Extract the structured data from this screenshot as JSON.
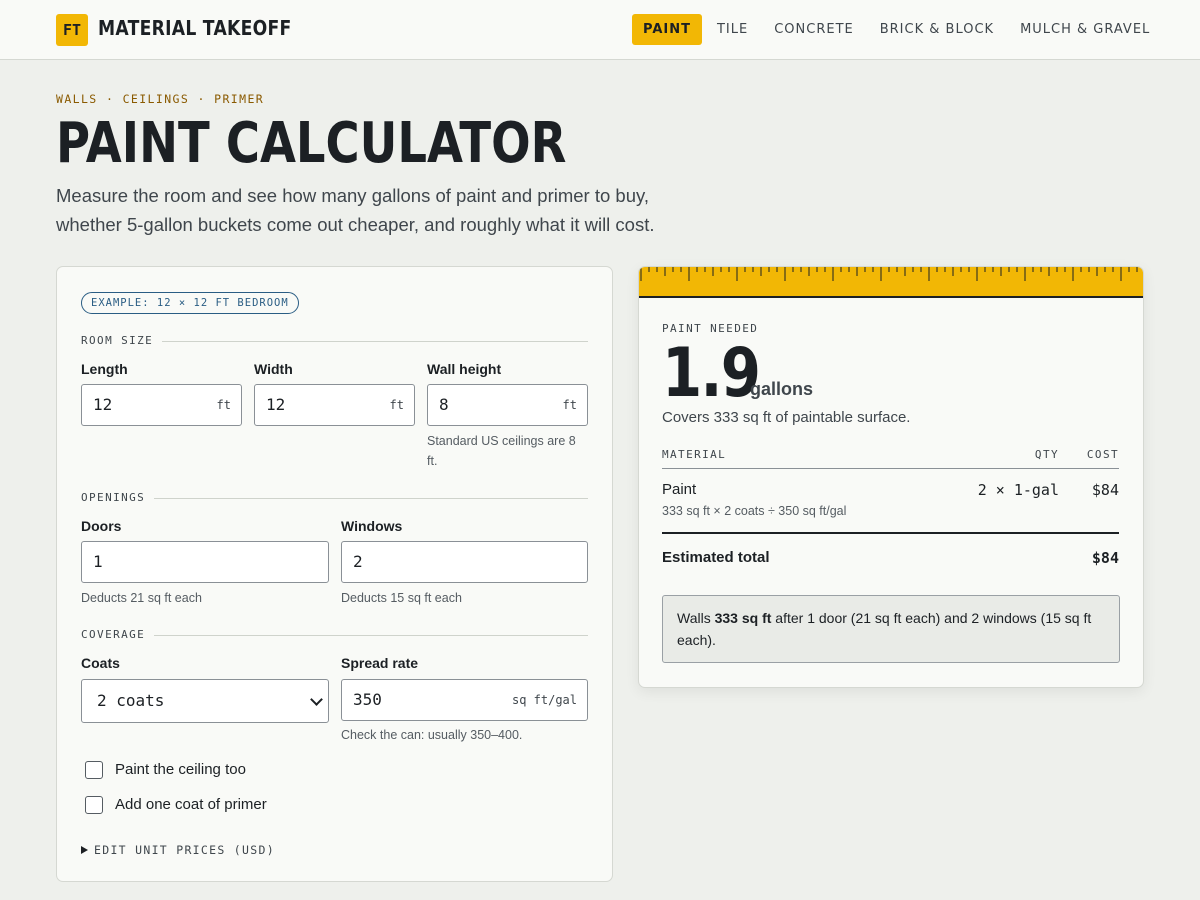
{
  "header": {
    "logo_text": "FT",
    "brand": "MATERIAL TAKEOFF",
    "nav": [
      {
        "label": "PAINT",
        "active": true
      },
      {
        "label": "TILE",
        "active": false
      },
      {
        "label": "CONCRETE",
        "active": false
      },
      {
        "label": "BRICK & BLOCK",
        "active": false
      },
      {
        "label": "MULCH & GRAVEL",
        "active": false
      }
    ]
  },
  "hero": {
    "eyebrow": "WALLS · CEILINGS · PRIMER",
    "title": "PAINT CALCULATOR",
    "intro_line1": "Measure the room and see how many gallons of paint and primer to buy,",
    "intro_line2": "whether 5-gallon buckets come out cheaper, and roughly what it will cost."
  },
  "form": {
    "example_badge": "EXAMPLE: 12 × 12 FT BEDROOM",
    "room_size": {
      "section_label": "ROOM SIZE",
      "length": {
        "label": "Length",
        "value": "12",
        "unit": "ft"
      },
      "width": {
        "label": "Width",
        "value": "12",
        "unit": "ft"
      },
      "height": {
        "label": "Wall height",
        "value": "8",
        "unit": "ft",
        "hint_line1": "Standard US ceilings are 8",
        "hint_line2": "ft."
      }
    },
    "openings": {
      "section_label": "OPENINGS",
      "doors": {
        "label": "Doors",
        "value": "1",
        "hint": "Deducts 21 sq ft each"
      },
      "windows": {
        "label": "Windows",
        "value": "2",
        "hint": "Deducts 15 sq ft each"
      }
    },
    "coverage": {
      "section_label": "COVERAGE",
      "coats": {
        "label": "Coats",
        "selected": "2 coats"
      },
      "spread": {
        "label": "Spread rate",
        "value": "350",
        "unit": "sq ft/gal",
        "hint": "Check the can: usually 350–400."
      }
    },
    "checkboxes": [
      {
        "label": "Paint the ceiling too",
        "checked": false
      },
      {
        "label": "Add one coat of primer",
        "checked": false
      }
    ],
    "unit_prices_toggle": "EDIT UNIT PRICES (USD)"
  },
  "result": {
    "eyebrow": "PAINT NEEDED",
    "amount": "1.9",
    "amount_unit": "gallons",
    "covers": "Covers 333 sq ft of paintable surface.",
    "table": {
      "headers": {
        "material": "MATERIAL",
        "qty": "QTY",
        "cost": "COST"
      },
      "rows": [
        {
          "material": "Paint",
          "qty": "2 × 1-gal",
          "cost": "$84",
          "detail": "333 sq ft × 2 coats ÷ 350 sq ft/gal"
        }
      ],
      "total_label": "Estimated total",
      "total_value": "$84"
    },
    "note": {
      "prefix": "Walls ",
      "bold": "333 sq ft",
      "suffix_line1": " after 1 door (21 sq ft each) and 2 windows (15 sq ft",
      "suffix_line2": "each)."
    }
  },
  "colors": {
    "accent": "#f2b705",
    "ink": "#1c2024",
    "eyebrow": "#8a5a00",
    "badge": "#2a5d84",
    "page_bg": "#eef0ec"
  }
}
